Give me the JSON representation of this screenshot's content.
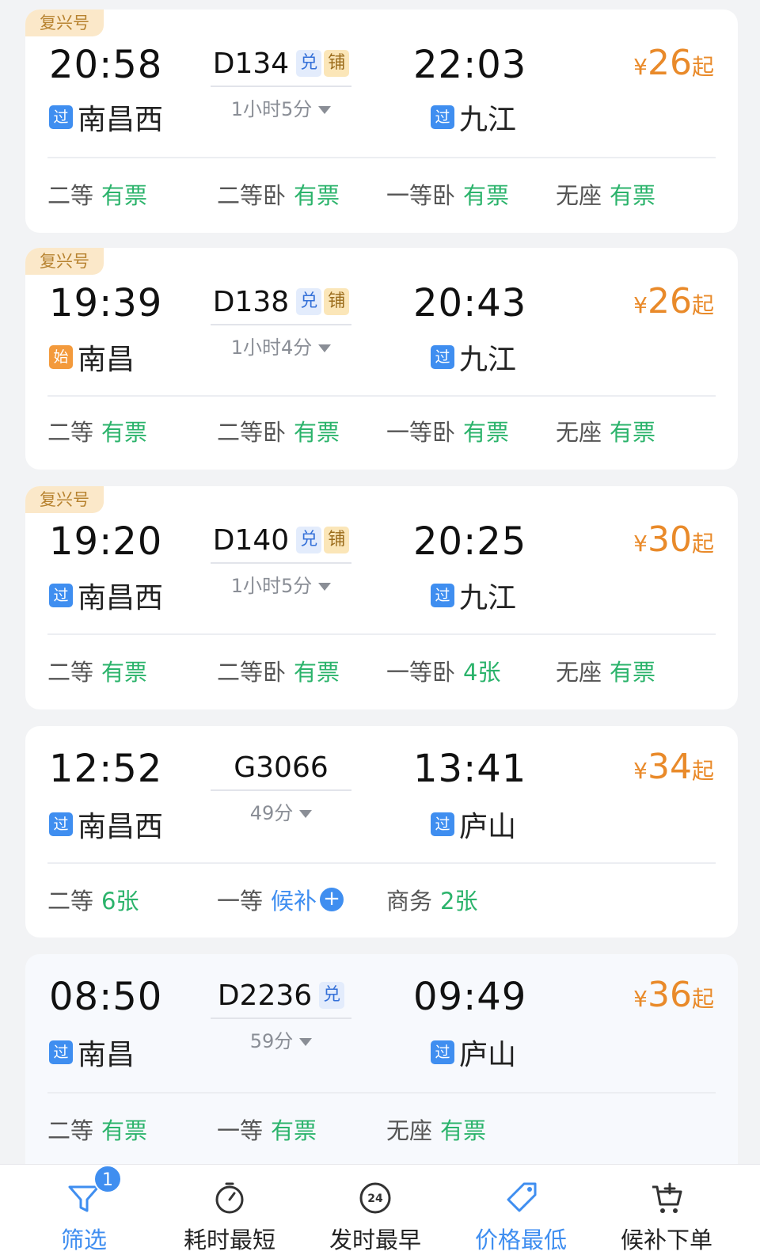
{
  "trains": [
    {
      "tag": "复兴号",
      "dep_time": "20:58",
      "dep_station_badge": "过",
      "dep_station": "南昌西",
      "train_no": "D134",
      "badges": [
        "兑",
        "铺"
      ],
      "duration": "1小时5分",
      "arr_time": "22:03",
      "arr_station_badge": "过",
      "arr_station": "九江",
      "price_yen": "¥",
      "price": "26",
      "price_suffix": "起",
      "seats": [
        {
          "class": "二等",
          "status": "有票"
        },
        {
          "class": "二等卧",
          "status": "有票"
        },
        {
          "class": "一等卧",
          "status": "有票"
        },
        {
          "class": "无座",
          "status": "有票"
        }
      ]
    },
    {
      "tag": "复兴号",
      "dep_time": "19:39",
      "dep_station_badge": "始",
      "dep_station": "南昌",
      "train_no": "D138",
      "badges": [
        "兑",
        "铺"
      ],
      "duration": "1小时4分",
      "arr_time": "20:43",
      "arr_station_badge": "过",
      "arr_station": "九江",
      "price_yen": "¥",
      "price": "26",
      "price_suffix": "起",
      "seats": [
        {
          "class": "二等",
          "status": "有票"
        },
        {
          "class": "二等卧",
          "status": "有票"
        },
        {
          "class": "一等卧",
          "status": "有票"
        },
        {
          "class": "无座",
          "status": "有票"
        }
      ]
    },
    {
      "tag": "复兴号",
      "dep_time": "19:20",
      "dep_station_badge": "过",
      "dep_station": "南昌西",
      "train_no": "D140",
      "badges": [
        "兑",
        "铺"
      ],
      "duration": "1小时5分",
      "arr_time": "20:25",
      "arr_station_badge": "过",
      "arr_station": "九江",
      "price_yen": "¥",
      "price": "30",
      "price_suffix": "起",
      "seats": [
        {
          "class": "二等",
          "status": "有票"
        },
        {
          "class": "二等卧",
          "status": "有票"
        },
        {
          "class": "一等卧",
          "status": "4张"
        },
        {
          "class": "无座",
          "status": "有票"
        }
      ]
    },
    {
      "dep_time": "12:52",
      "dep_station_badge": "过",
      "dep_station": "南昌西",
      "train_no": "G3066",
      "duration": "49分",
      "arr_time": "13:41",
      "arr_station_badge": "过",
      "arr_station": "庐山",
      "price_yen": "¥",
      "price": "34",
      "price_suffix": "起",
      "seats": [
        {
          "class": "二等",
          "status": "6张"
        },
        {
          "class": "一等",
          "status": "候补"
        },
        {
          "class": "商务",
          "status": "2张"
        }
      ]
    },
    {
      "dep_time": "08:50",
      "dep_station_badge": "过",
      "dep_station": "南昌",
      "train_no": "D2236",
      "badges": [
        "兑"
      ],
      "duration": "59分",
      "arr_time": "09:49",
      "arr_station_badge": "过",
      "arr_station": "庐山",
      "price_yen": "¥",
      "price": "36",
      "price_suffix": "起",
      "seats": [
        {
          "class": "二等",
          "status": "有票"
        },
        {
          "class": "一等",
          "status": "有票"
        },
        {
          "class": "无座",
          "status": "有票"
        }
      ]
    }
  ],
  "bottom_bar": {
    "filter_badge": "1",
    "tabs": [
      {
        "label": "筛选",
        "icon": "filter-icon"
      },
      {
        "label": "耗时最短",
        "icon": "stopwatch-icon"
      },
      {
        "label": "发时最早",
        "icon": "clock-24-icon"
      },
      {
        "label": "价格最低",
        "icon": "price-tag-icon"
      },
      {
        "label": "候补下单",
        "icon": "cart-plus-icon"
      }
    ]
  },
  "colors": {
    "accent_blue": "#3f8ef0",
    "available_green": "#2bb36b",
    "price_orange": "#e98a2a",
    "tag_gold": "#fbe8c9"
  }
}
